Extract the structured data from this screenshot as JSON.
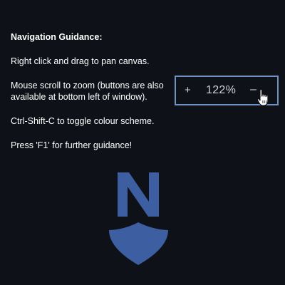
{
  "guidance": {
    "title": "Navigation Guidance:",
    "pan": "Right click and drag to pan canvas.",
    "zoom": "Mouse scroll to zoom (buttons are also available at bottom left of window).",
    "colour": "Ctrl-Shift-C to toggle colour scheme.",
    "help": "Press 'F1' for further guidance!"
  },
  "zoom_control": {
    "plus_label": "+",
    "level": "122%",
    "minus_label": "–"
  },
  "logo": {
    "letter": "N",
    "color": "#3d5ea1"
  },
  "colors": {
    "background": "#0e1117",
    "zoom_border": "#6e92c2"
  }
}
